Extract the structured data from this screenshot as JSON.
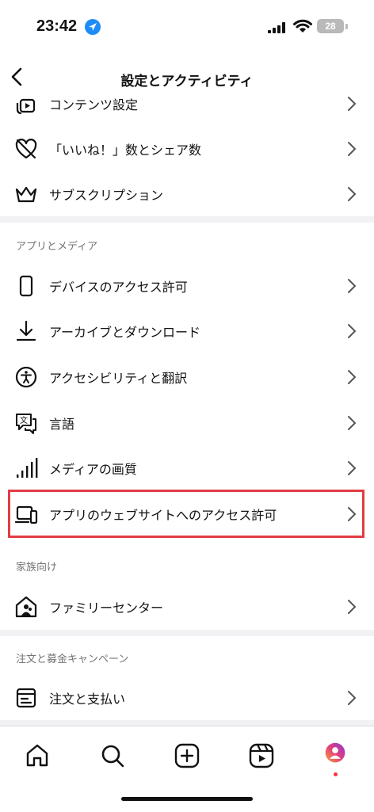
{
  "status": {
    "time": "23:42",
    "battery": "28"
  },
  "header": {
    "title": "設定とアクティビティ"
  },
  "top_items": [
    {
      "label": "コンテンツ設定",
      "icon": "content-settings-icon"
    },
    {
      "label": "「いいね！」数とシェア数",
      "icon": "heart-slash-icon"
    },
    {
      "label": "サブスクリプション",
      "icon": "crown-icon"
    }
  ],
  "section_apps": {
    "title": "アプリとメディア",
    "items": [
      {
        "label": "デバイスのアクセス許可",
        "icon": "phone-icon"
      },
      {
        "label": "アーカイブとダウンロード",
        "icon": "download-icon"
      },
      {
        "label": "アクセシビリティと翻訳",
        "icon": "accessibility-icon"
      },
      {
        "label": "言語",
        "icon": "translate-icon"
      },
      {
        "label": "メディアの画質",
        "icon": "signal-bars-icon"
      },
      {
        "label": "アプリのウェブサイトへのアクセス許可",
        "icon": "devices-icon"
      }
    ]
  },
  "section_family": {
    "title": "家族向け",
    "items": [
      {
        "label": "ファミリーセンター",
        "icon": "family-home-icon"
      }
    ]
  },
  "section_orders": {
    "title": "注文と募金キャンペーン",
    "items": [
      {
        "label": "注文と支払い",
        "icon": "receipt-icon"
      }
    ]
  },
  "tabbar": [
    "home-icon",
    "search-icon",
    "create-icon",
    "reels-icon",
    "profile-avatar"
  ],
  "colors": {
    "highlight": "#e23c44",
    "section_bg": "#f2f2f4",
    "muted_text": "#737373"
  }
}
